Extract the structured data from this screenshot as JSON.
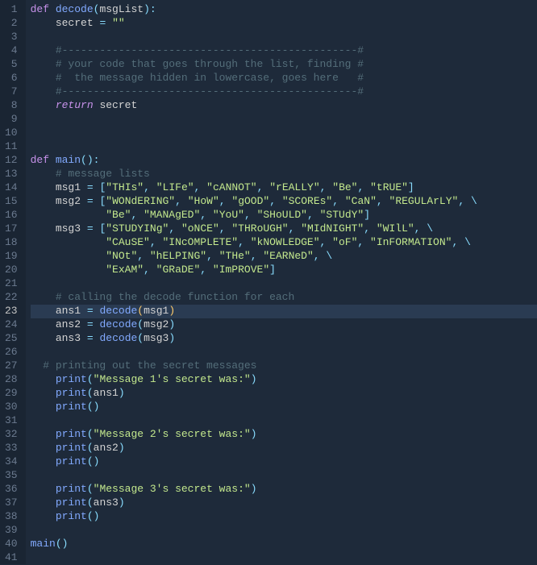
{
  "lines": [
    {
      "n": 1,
      "html": "<span class='kw'>def</span> <span class='fn'>decode</span><span class='pn'>(</span><span class='var'>msgList</span><span class='pn'>):</span>"
    },
    {
      "n": 2,
      "html": "    <span class='var'>secret</span> <span class='pn'>=</span> <span class='str'>\"\"</span>"
    },
    {
      "n": 3,
      "html": ""
    },
    {
      "n": 4,
      "html": "    <span class='cmt'>#-----------------------------------------------#</span>"
    },
    {
      "n": 5,
      "html": "    <span class='cmt'># your code that goes through the list, finding #</span>"
    },
    {
      "n": 6,
      "html": "    <span class='cmt'>#  the message hidden in lowercase, goes here   #</span>"
    },
    {
      "n": 7,
      "html": "    <span class='cmt'>#-----------------------------------------------#</span>"
    },
    {
      "n": 8,
      "html": "    <span class='ret'>return</span> <span class='var'>secret</span>"
    },
    {
      "n": 9,
      "html": ""
    },
    {
      "n": 10,
      "html": ""
    },
    {
      "n": 11,
      "html": ""
    },
    {
      "n": 12,
      "html": "<span class='kw'>def</span> <span class='fn'>main</span><span class='pn'>():</span>"
    },
    {
      "n": 13,
      "html": "    <span class='cmt'># message lists</span>"
    },
    {
      "n": 14,
      "html": "    <span class='var'>msg1</span> <span class='pn'>=</span> <span class='pn'>[</span><span class='str'>\"THIs\"</span><span class='pn'>,</span> <span class='str'>\"LIFe\"</span><span class='pn'>,</span> <span class='str'>\"cANNOT\"</span><span class='pn'>,</span> <span class='str'>\"rEALLY\"</span><span class='pn'>,</span> <span class='str'>\"Be\"</span><span class='pn'>,</span> <span class='str'>\"tRUE\"</span><span class='pn'>]</span>"
    },
    {
      "n": 15,
      "html": "    <span class='var'>msg2</span> <span class='pn'>=</span> <span class='pn'>[</span><span class='str'>\"WONdERING\"</span><span class='pn'>,</span> <span class='str'>\"HoW\"</span><span class='pn'>,</span> <span class='str'>\"gOOD\"</span><span class='pn'>,</span> <span class='str'>\"SCOREs\"</span><span class='pn'>,</span> <span class='str'>\"CaN\"</span><span class='pn'>,</span> <span class='str'>\"REGULArLY\"</span><span class='pn'>,</span> <span class='pn'>\\</span>"
    },
    {
      "n": 16,
      "html": "            <span class='str'>\"Be\"</span><span class='pn'>,</span> <span class='str'>\"MANAgED\"</span><span class='pn'>,</span> <span class='str'>\"YoU\"</span><span class='pn'>,</span> <span class='str'>\"SHoULD\"</span><span class='pn'>,</span> <span class='str'>\"STUdY\"</span><span class='pn'>]</span>"
    },
    {
      "n": 17,
      "html": "    <span class='var'>msg3</span> <span class='pn'>=</span> <span class='pn'>[</span><span class='str'>\"STUDYINg\"</span><span class='pn'>,</span> <span class='str'>\"oNCE\"</span><span class='pn'>,</span> <span class='str'>\"THRoUGH\"</span><span class='pn'>,</span> <span class='str'>\"MIdNIGHT\"</span><span class='pn'>,</span> <span class='str'>\"WIlL\"</span><span class='pn'>,</span> <span class='pn'>\\</span>"
    },
    {
      "n": 18,
      "html": "            <span class='str'>\"CAuSE\"</span><span class='pn'>,</span> <span class='str'>\"INcOMPLETE\"</span><span class='pn'>,</span> <span class='str'>\"kNOWLEDGE\"</span><span class='pn'>,</span> <span class='str'>\"oF\"</span><span class='pn'>,</span> <span class='str'>\"InFORMATION\"</span><span class='pn'>,</span> <span class='pn'>\\</span>"
    },
    {
      "n": 19,
      "html": "            <span class='str'>\"NOt\"</span><span class='pn'>,</span> <span class='str'>\"hELPING\"</span><span class='pn'>,</span> <span class='str'>\"THe\"</span><span class='pn'>,</span> <span class='str'>\"EARNeD\"</span><span class='pn'>,</span> <span class='pn'>\\</span>"
    },
    {
      "n": 20,
      "html": "            <span class='str'>\"ExAM\"</span><span class='pn'>,</span> <span class='str'>\"GRaDE\"</span><span class='pn'>,</span> <span class='str'>\"ImPROVE\"</span><span class='pn'>]</span>"
    },
    {
      "n": 21,
      "html": ""
    },
    {
      "n": 22,
      "html": "    <span class='cmt'># calling the decode function for each</span>"
    },
    {
      "n": 23,
      "html": "    <span class='var'>ans1</span> <span class='pn'>=</span> <span class='fn'>decode</span><span class='paren'>(</span><span class='var'>msg1</span><span class='paren'>)</span>",
      "active": true
    },
    {
      "n": 24,
      "html": "    <span class='var'>ans2</span> <span class='pn'>=</span> <span class='fn'>decode</span><span class='pn'>(</span><span class='var'>msg2</span><span class='pn'>)</span>"
    },
    {
      "n": 25,
      "html": "    <span class='var'>ans3</span> <span class='pn'>=</span> <span class='fn'>decode</span><span class='pn'>(</span><span class='var'>msg3</span><span class='pn'>)</span>"
    },
    {
      "n": 26,
      "html": ""
    },
    {
      "n": 27,
      "html": "  <span class='cmt'># printing out the secret messages</span>"
    },
    {
      "n": 28,
      "html": "    <span class='fn'>print</span><span class='pn'>(</span><span class='str'>\"Message 1's secret was:\"</span><span class='pn'>)</span>"
    },
    {
      "n": 29,
      "html": "    <span class='fn'>print</span><span class='pn'>(</span><span class='var'>ans1</span><span class='pn'>)</span>"
    },
    {
      "n": 30,
      "html": "    <span class='fn'>print</span><span class='pn'>()</span>"
    },
    {
      "n": 31,
      "html": ""
    },
    {
      "n": 32,
      "html": "    <span class='fn'>print</span><span class='pn'>(</span><span class='str'>\"Message 2's secret was:\"</span><span class='pn'>)</span>"
    },
    {
      "n": 33,
      "html": "    <span class='fn'>print</span><span class='pn'>(</span><span class='var'>ans2</span><span class='pn'>)</span>"
    },
    {
      "n": 34,
      "html": "    <span class='fn'>print</span><span class='pn'>()</span>"
    },
    {
      "n": 35,
      "html": ""
    },
    {
      "n": 36,
      "html": "    <span class='fn'>print</span><span class='pn'>(</span><span class='str'>\"Message 3's secret was:\"</span><span class='pn'>)</span>"
    },
    {
      "n": 37,
      "html": "    <span class='fn'>print</span><span class='pn'>(</span><span class='var'>ans3</span><span class='pn'>)</span>"
    },
    {
      "n": 38,
      "html": "    <span class='fn'>print</span><span class='pn'>()</span>"
    },
    {
      "n": 39,
      "html": ""
    },
    {
      "n": 40,
      "html": "<span class='fn'>main</span><span class='pn'>()</span>"
    },
    {
      "n": 41,
      "html": ""
    }
  ],
  "active_line": 23,
  "colors": {
    "bg": "#1e2a3a",
    "gutter_bg": "#1a2533",
    "gutter_fg": "#6b7a8f",
    "keyword": "#c792ea",
    "function": "#82aaff",
    "string": "#c3e88d",
    "comment": "#546e7a",
    "punct": "#89ddff",
    "highlight": "#2a3b52"
  }
}
